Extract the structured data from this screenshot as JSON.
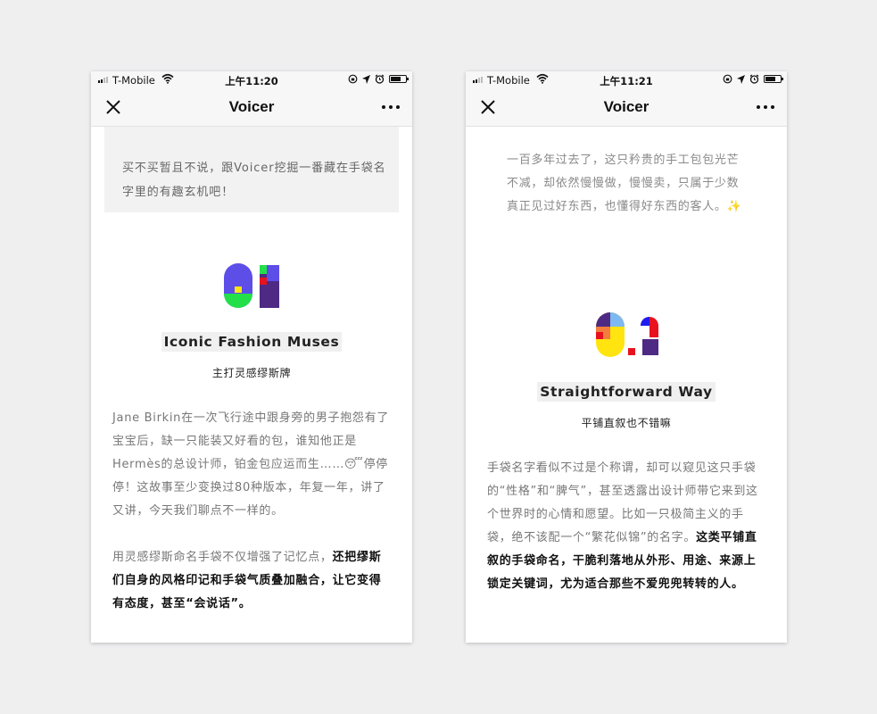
{
  "phones": [
    {
      "status": {
        "carrier": "T-Mobile",
        "time": "上午11:20"
      },
      "nav": {
        "title": "Voicer"
      },
      "intro": "买不买暂且不说，跟Voicer挖掘一番藏在手袋名字里的有趣玄机吧！",
      "section": {
        "number": "01",
        "title_en": "Iconic Fashion Muses",
        "title_zh": "主打灵感缪斯牌"
      },
      "para1": "Jane Birkin在一次飞行途中跟身旁的男子抱怨有了宝宝后，缺一只能装又好看的包，谁知他正是Hermès的总设计师，铂金包应运而生……😴停停停！这故事至少变换过80种版本，年复一年，讲了又讲，今天我们聊点不一样的。",
      "para2_normal": "用灵感缪斯命名手袋不仅增强了记忆点，",
      "para2_bold": "还把缪斯们自身的风格印记和手袋气质叠加融合，让它变得有态度，甚至“会说话”。"
    },
    {
      "status": {
        "carrier": "T-Mobile",
        "time": "上午11:21"
      },
      "nav": {
        "title": "Voicer"
      },
      "intro": "一百多年过去了，这只矜贵的手工包包光芒不减，却依然慢慢做，慢慢卖，只属于少数真正见过好东西，也懂得好东西的客人。✨",
      "section": {
        "number": "02",
        "title_en": "Straightforward Way",
        "title_zh": "平铺直叙也不错嘛"
      },
      "para1_normal": "手袋名字看似不过是个称谓，却可以窥见这只手袋的“性格”和“脾气”，甚至透露出设计师带它来到这个世界时的心情和愿望。比如一只极简主义的手袋，绝不该配一个“繁花似锦”的名字。",
      "para1_bold": "这类平铺直叙的手袋命名，干脆利落地从外形、用途、来源上锁定关键词，尤为适合那些不爱兜兜转转的人。"
    }
  ],
  "icons": [
    "signal-icon",
    "wifi-icon",
    "lock-rotation-icon",
    "location-icon",
    "alarm-icon",
    "battery-icon",
    "close-icon",
    "more-icon"
  ],
  "colors": {
    "purple": "#5d4ee8",
    "green": "#23e04a",
    "dark_purple": "#4e2a84",
    "red": "#e8121f",
    "yellow": "#ffe40f",
    "blue": "#1f1cf0",
    "light_blue": "#7eb8f0",
    "orange": "#f27d3c"
  }
}
